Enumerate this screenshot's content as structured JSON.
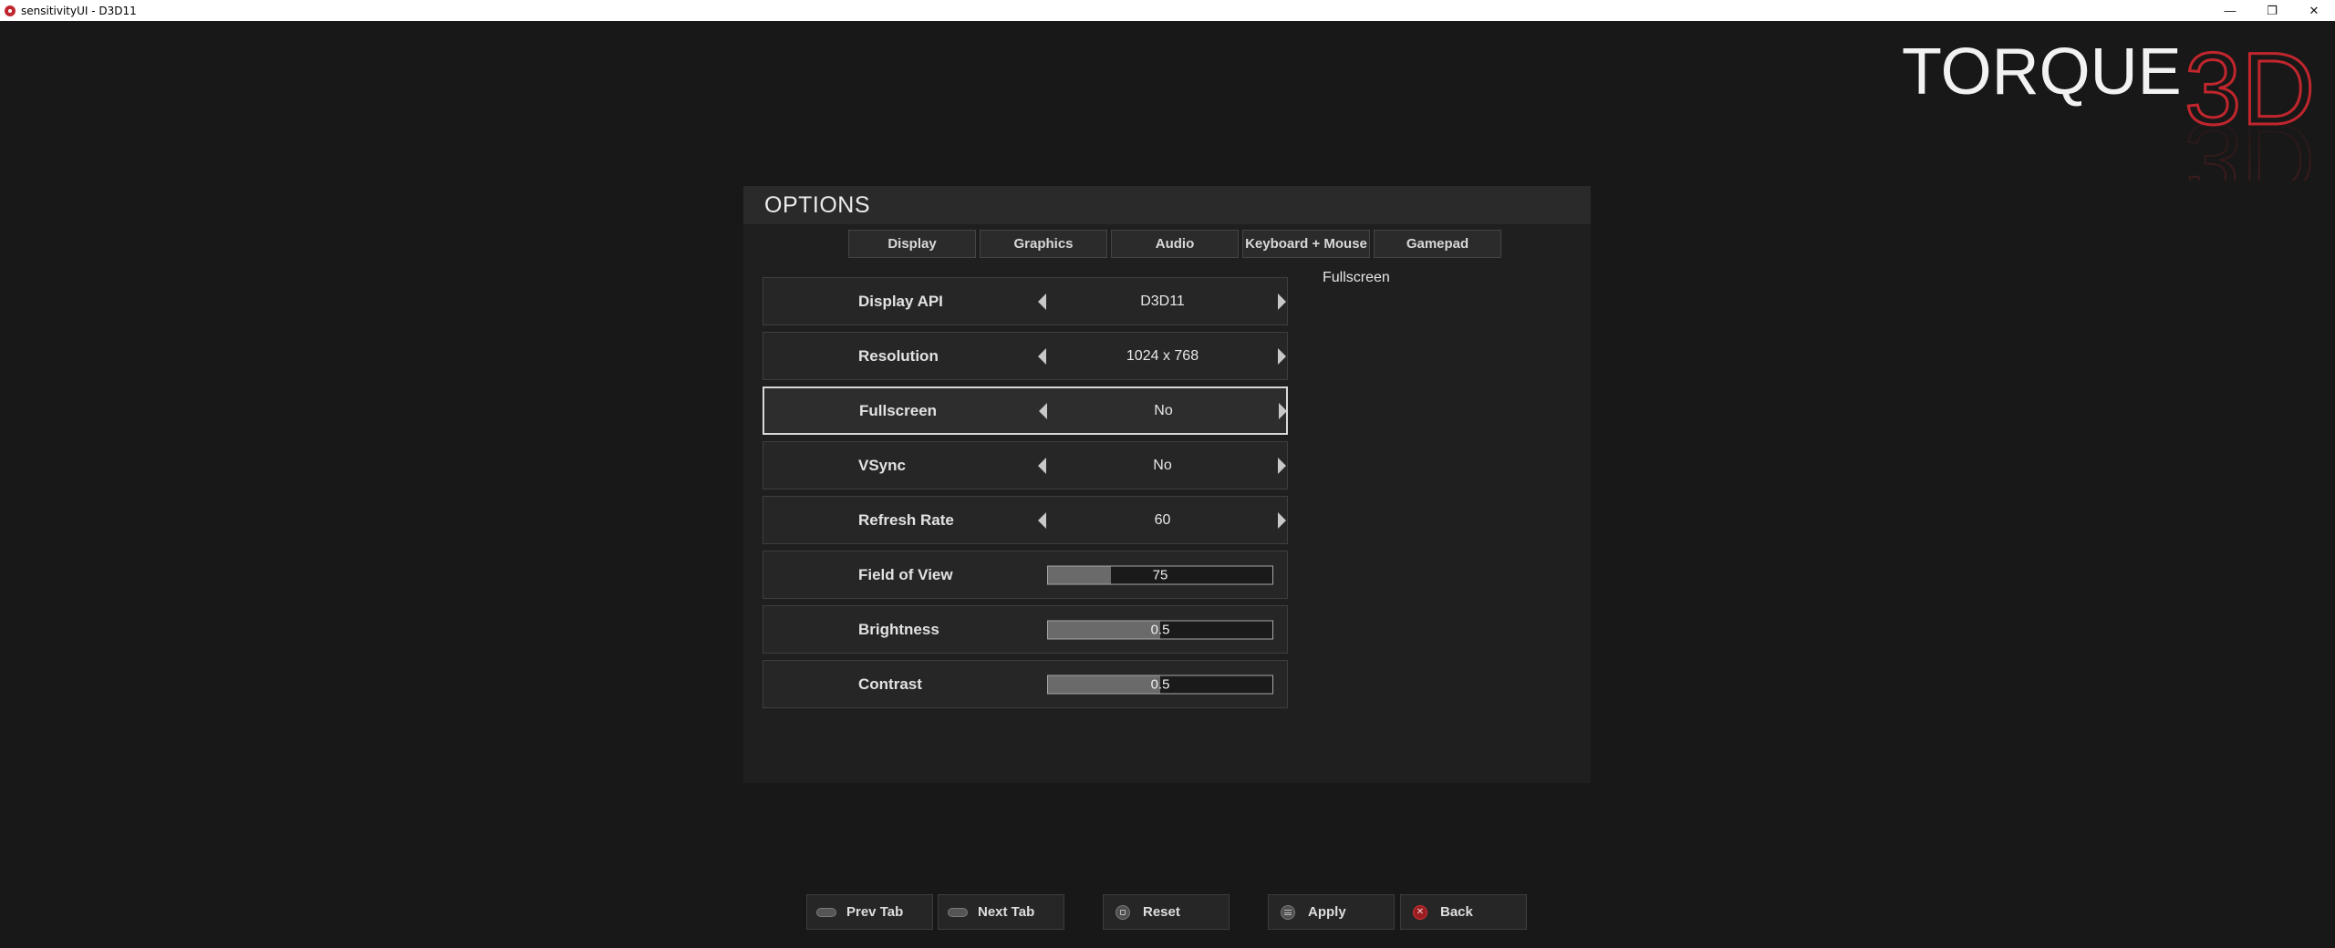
{
  "window": {
    "title": "sensitivityUI - D3D11",
    "minimize_glyph": "—",
    "restore_glyph": "❐",
    "close_glyph": "✕"
  },
  "logo": {
    "text_main": "TORQUE",
    "text_3d": "3D",
    "accent_color": "#c0262d"
  },
  "options": {
    "title": "OPTIONS",
    "tabs": [
      {
        "label": "Display"
      },
      {
        "label": "Graphics"
      },
      {
        "label": "Audio"
      },
      {
        "label": "Keyboard + Mouse"
      },
      {
        "label": "Gamepad"
      }
    ],
    "description": "Fullscreen",
    "settings": [
      {
        "label": "Display API",
        "value": "D3D11",
        "type": "choice"
      },
      {
        "label": "Resolution",
        "value": "1024 x 768",
        "type": "choice"
      },
      {
        "label": "Fullscreen",
        "value": "No",
        "type": "choice",
        "selected": true
      },
      {
        "label": "VSync",
        "value": "No",
        "type": "choice"
      },
      {
        "label": "Refresh Rate",
        "value": "60",
        "type": "choice"
      },
      {
        "label": "Field of View",
        "value": "75",
        "type": "slider",
        "fill_fraction": 0.28
      },
      {
        "label": "Brightness",
        "value": "0.5",
        "type": "slider",
        "fill_fraction": 0.5
      },
      {
        "label": "Contrast",
        "value": "0.5",
        "type": "slider",
        "fill_fraction": 0.5
      }
    ]
  },
  "bottom_bar": {
    "prev_tab": "Prev Tab",
    "next_tab": "Next Tab",
    "reset": "Reset",
    "apply": "Apply",
    "back": "Back"
  }
}
